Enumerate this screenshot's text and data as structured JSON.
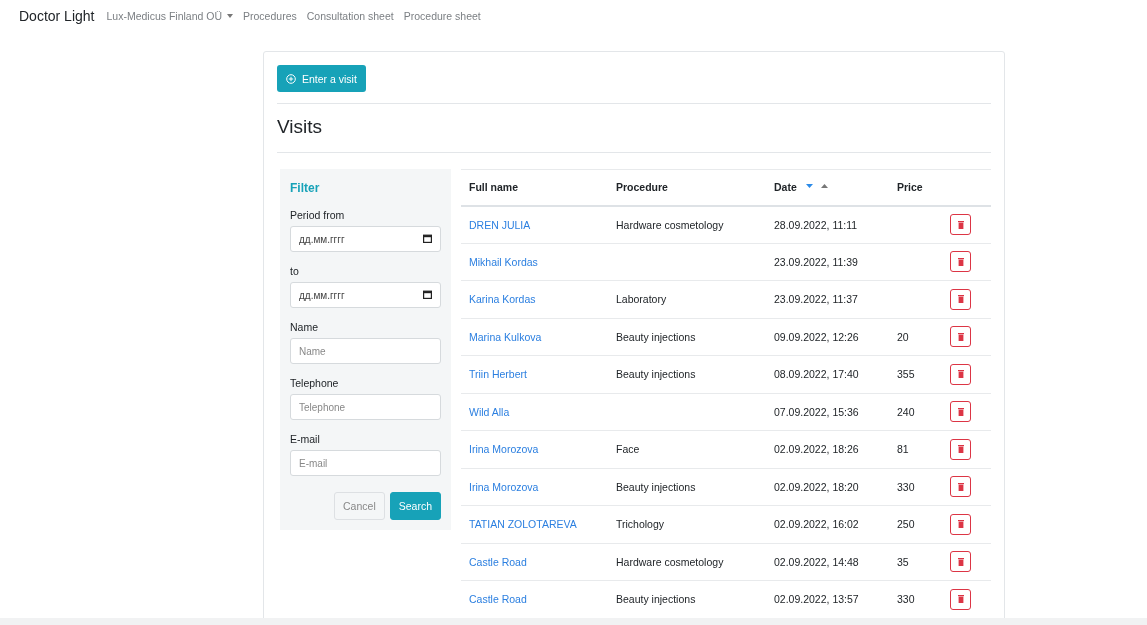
{
  "navbar": {
    "brand": "Doctor Light",
    "items": [
      {
        "label": "Lux-Medicus Finland OÜ",
        "kind": "dropdown"
      },
      {
        "label": "Procedures",
        "kind": "link"
      },
      {
        "label": "Consultation sheet",
        "kind": "link"
      },
      {
        "label": "Procedure sheet",
        "kind": "link"
      }
    ]
  },
  "add_button": "Enter a visit",
  "title": "Visits",
  "filter": {
    "title": "Filter",
    "fields": [
      {
        "label": "Period from",
        "kind": "date",
        "placeholder": "дд.мм.гггг"
      },
      {
        "label": "to",
        "kind": "date",
        "placeholder": "дд.мм.гггг"
      },
      {
        "label": "Name",
        "kind": "text",
        "placeholder": "Name"
      },
      {
        "label": "Telephone",
        "kind": "text",
        "placeholder": "Telephone"
      },
      {
        "label": "E-mail",
        "kind": "text",
        "placeholder": "E-mail"
      }
    ],
    "cancel": "Cancel",
    "search": "Search"
  },
  "table": {
    "columns": [
      {
        "label": "Full name"
      },
      {
        "label": "Procedure"
      },
      {
        "label": "Date",
        "sorted_descending": true
      },
      {
        "label": "Price"
      }
    ],
    "rows": [
      {
        "name": "DREN JULIA",
        "procedure": "Hardware cosmetology",
        "date": "28.09.2022, 11:11"
      },
      {
        "name": "Mikhail Kordas",
        "date": "23.09.2022, 11:39"
      },
      {
        "name": "Karina Kordas",
        "procedure": "Laboratory",
        "date": "23.09.2022, 11:37"
      },
      {
        "name": "Marina Kulkova",
        "procedure": "Beauty injections",
        "date": "09.09.2022, 12:26",
        "price": "20"
      },
      {
        "name": "Triin Herbert",
        "procedure": "Beauty injections",
        "date": "08.09.2022, 17:40",
        "price": "355"
      },
      {
        "name": "Wild Alla",
        "date": "07.09.2022, 15:36",
        "price": "240"
      },
      {
        "name": "Irina Morozova",
        "procedure": "Face",
        "date": "02.09.2022, 18:26",
        "price": "81"
      },
      {
        "name": "Irina Morozova",
        "procedure": "Beauty injections",
        "date": "02.09.2022, 18:20",
        "price": "330"
      },
      {
        "name": "TATIAN ZOLOTAREVA",
        "procedure": "Trichology",
        "date": "02.09.2022, 16:02",
        "price": "250"
      },
      {
        "name": "Castle Road",
        "procedure": "Hardware cosmetology",
        "date": "02.09.2022, 14:48",
        "price": "35"
      },
      {
        "name": "Castle Road",
        "procedure": "Beauty injections",
        "date": "02.09.2022, 13:57",
        "price": "330"
      }
    ]
  }
}
